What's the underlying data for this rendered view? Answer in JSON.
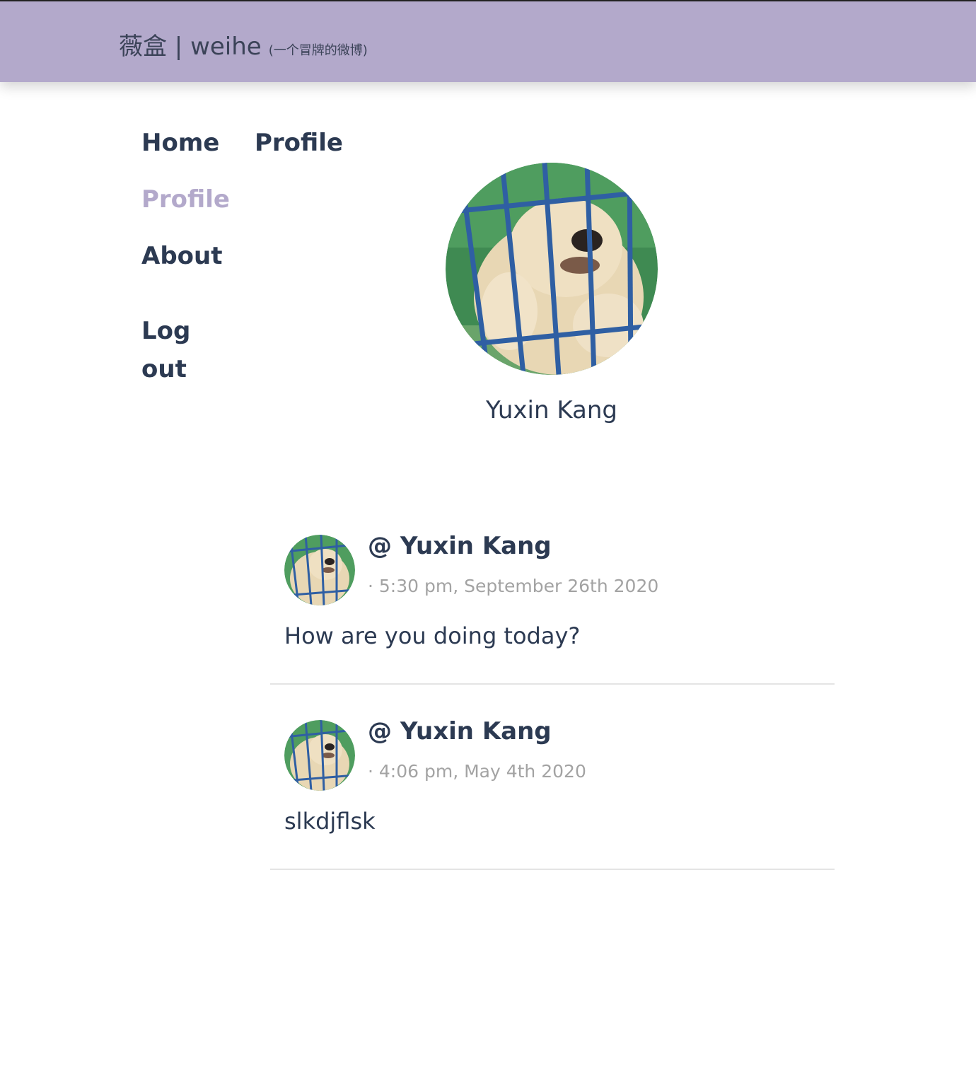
{
  "header": {
    "title": "薇盒 | weihe",
    "subtitle": "(一个冒牌的微博)"
  },
  "nav": {
    "items": [
      {
        "label": "Home"
      },
      {
        "label": "Profile"
      },
      {
        "label": "About"
      },
      {
        "label": "Log out"
      }
    ],
    "active_color": "#b3a9cb"
  },
  "page": {
    "title": "Profile"
  },
  "profile": {
    "name": "Yuxin Kang",
    "avatar_icon": "puppy-avatar"
  },
  "posts": [
    {
      "author": "@ Yuxin Kang",
      "time": "· 5:30 pm, September 26th 2020",
      "text": "How are you doing today?"
    },
    {
      "author": "@ Yuxin Kang",
      "time": "· 4:06 pm, May 4th 2020",
      "text": "slkdjflsk"
    }
  ],
  "colors": {
    "header_bg": "#b3a9cb",
    "text": "#2c3a52",
    "muted": "#a3a3a3"
  }
}
